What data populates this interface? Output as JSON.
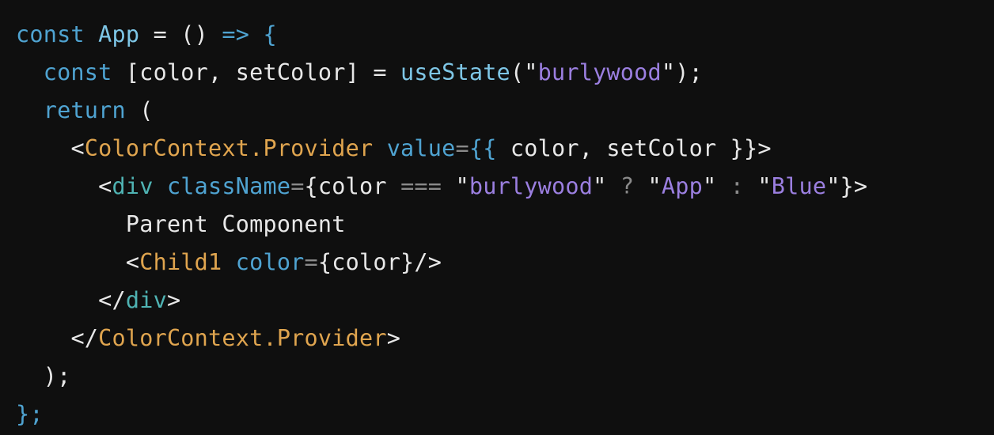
{
  "editor": {
    "background": "#0f0f0f",
    "lines": [
      {
        "indent": "",
        "tokens": [
          {
            "text": "const",
            "color": "#4fa3d1"
          },
          {
            "text": " ",
            "color": "#e8e8e8"
          },
          {
            "text": "App",
            "color": "#7ec6e6"
          },
          {
            "text": " = () ",
            "color": "#e8e8e8"
          },
          {
            "text": "=>",
            "color": "#4fa3d1"
          },
          {
            "text": " {",
            "color": "#4fa3d1"
          }
        ]
      },
      {
        "indent": "  ",
        "tokens": [
          {
            "text": "const",
            "color": "#4fa3d1"
          },
          {
            "text": " [color, setColor] = ",
            "color": "#e8e8e8"
          },
          {
            "text": "useState",
            "color": "#7ec6e6"
          },
          {
            "text": "(\"",
            "color": "#e8e8e8"
          },
          {
            "text": "burlywood",
            "color": "#9b7fe0"
          },
          {
            "text": "\");",
            "color": "#e8e8e8"
          }
        ]
      },
      {
        "indent": "  ",
        "tokens": [
          {
            "text": "return",
            "color": "#4fa3d1"
          },
          {
            "text": " (",
            "color": "#e8e8e8"
          }
        ]
      },
      {
        "indent": "    ",
        "tokens": [
          {
            "text": "<",
            "color": "#e8e8e8"
          },
          {
            "text": "ColorContext.Provider",
            "color": "#e0a54f"
          },
          {
            "text": " ",
            "color": "#e8e8e8"
          },
          {
            "text": "value",
            "color": "#4fa3d1"
          },
          {
            "text": "=",
            "color": "#8a8a8a"
          },
          {
            "text": "{{",
            "color": "#4fa3d1"
          },
          {
            "text": " color, setColor }}>",
            "color": "#e8e8e8"
          }
        ]
      },
      {
        "indent": "      ",
        "tokens": [
          {
            "text": "<",
            "color": "#e8e8e8"
          },
          {
            "text": "div",
            "color": "#4fb3b3"
          },
          {
            "text": " ",
            "color": "#e8e8e8"
          },
          {
            "text": "className",
            "color": "#4fa3d1"
          },
          {
            "text": "=",
            "color": "#8a8a8a"
          },
          {
            "text": "{color ",
            "color": "#e8e8e8"
          },
          {
            "text": "===",
            "color": "#8a8a8a"
          },
          {
            "text": " \"",
            "color": "#e8e8e8"
          },
          {
            "text": "burlywood",
            "color": "#9b7fe0"
          },
          {
            "text": "\" ",
            "color": "#e8e8e8"
          },
          {
            "text": "?",
            "color": "#8a8a8a"
          },
          {
            "text": " \"",
            "color": "#e8e8e8"
          },
          {
            "text": "App",
            "color": "#9b7fe0"
          },
          {
            "text": "\" ",
            "color": "#e8e8e8"
          },
          {
            "text": ":",
            "color": "#8a8a8a"
          },
          {
            "text": " \"",
            "color": "#e8e8e8"
          },
          {
            "text": "Blue",
            "color": "#9b7fe0"
          },
          {
            "text": "\"}>",
            "color": "#e8e8e8"
          }
        ]
      },
      {
        "indent": "        ",
        "tokens": [
          {
            "text": "Parent Component",
            "color": "#e8e8e8"
          }
        ]
      },
      {
        "indent": "        ",
        "tokens": [
          {
            "text": "<",
            "color": "#e8e8e8"
          },
          {
            "text": "Child1",
            "color": "#e0a54f"
          },
          {
            "text": " ",
            "color": "#e8e8e8"
          },
          {
            "text": "color",
            "color": "#4fa3d1"
          },
          {
            "text": "=",
            "color": "#8a8a8a"
          },
          {
            "text": "{color}/>",
            "color": "#e8e8e8"
          }
        ]
      },
      {
        "indent": "      ",
        "tokens": [
          {
            "text": "</",
            "color": "#e8e8e8"
          },
          {
            "text": "div",
            "color": "#4fb3b3"
          },
          {
            "text": ">",
            "color": "#e8e8e8"
          }
        ]
      },
      {
        "indent": "    ",
        "tokens": [
          {
            "text": "</",
            "color": "#e8e8e8"
          },
          {
            "text": "ColorContext.Provider",
            "color": "#e0a54f"
          },
          {
            "text": ">",
            "color": "#e8e8e8"
          }
        ]
      },
      {
        "indent": "  ",
        "tokens": [
          {
            "text": ");",
            "color": "#e8e8e8"
          }
        ]
      },
      {
        "indent": "",
        "tokens": [
          {
            "text": "};",
            "color": "#4fa3d1"
          }
        ]
      }
    ]
  }
}
